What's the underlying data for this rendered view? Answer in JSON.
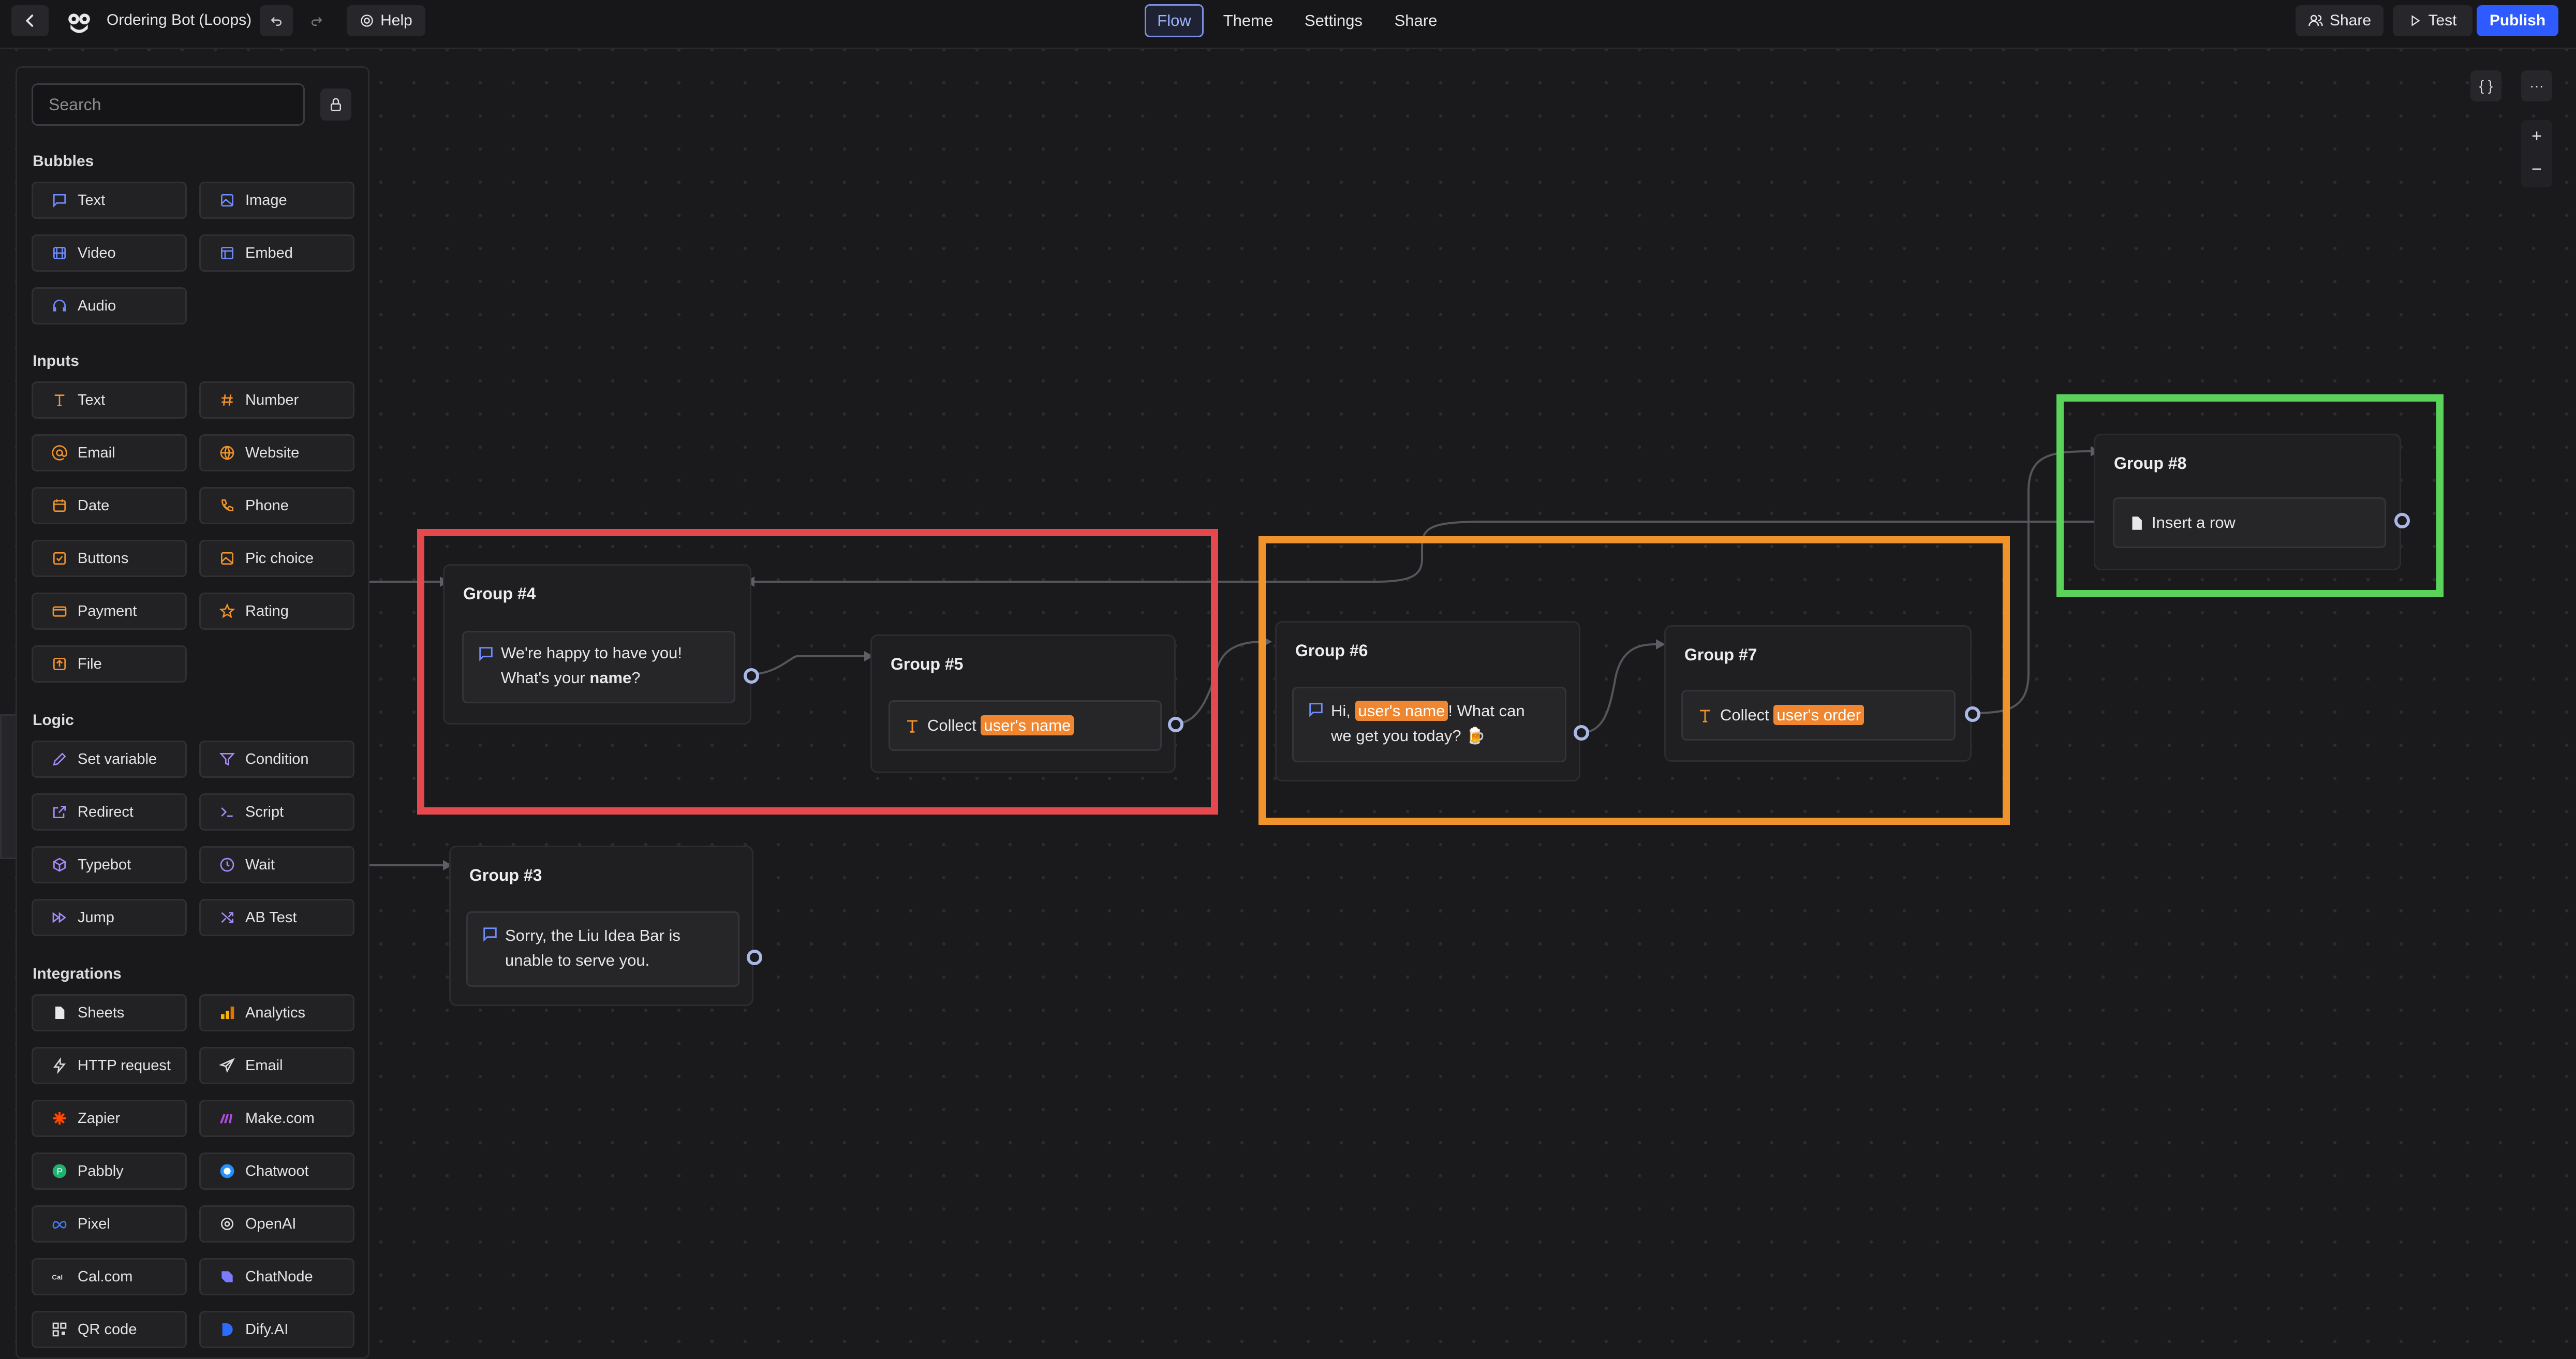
{
  "header": {
    "back_label": "",
    "bot_name": "Ordering Bot (Loops)",
    "help_label": "Help",
    "tabs": [
      {
        "label": "Flow",
        "active": true
      },
      {
        "label": "Theme",
        "active": false
      },
      {
        "label": "Settings",
        "active": false
      },
      {
        "label": "Share",
        "active": false
      }
    ],
    "share_label": "Share",
    "test_label": "Test",
    "publish_label": "Publish"
  },
  "sidebar": {
    "search_placeholder": "Search",
    "sections": {
      "bubbles": "Bubbles",
      "inputs": "Inputs",
      "logic": "Logic",
      "integrations": "Integrations"
    },
    "bubbles": [
      "Text",
      "Image",
      "Video",
      "Embed",
      "Audio"
    ],
    "inputs": [
      "Text",
      "Number",
      "Email",
      "Website",
      "Date",
      "Phone",
      "Buttons",
      "Pic choice",
      "Payment",
      "Rating",
      "File"
    ],
    "logic": [
      "Set variable",
      "Condition",
      "Redirect",
      "Script",
      "Typebot",
      "Wait",
      "Jump",
      "AB Test"
    ],
    "integrations": [
      "Sheets",
      "Analytics",
      "HTTP request",
      "Email",
      "Zapier",
      "Make.com",
      "Pabbly",
      "Chatwoot",
      "Pixel",
      "OpenAI",
      "Cal.com",
      "ChatNode",
      "QR code",
      "Dify.AI"
    ]
  },
  "canvas": {
    "variables_button": "{ }",
    "more_button": "···",
    "zoom_in": "+",
    "zoom_out": "−",
    "groups": {
      "g4": {
        "title": "Group #4",
        "line1": "We're happy to have you!",
        "line2_pre": "What's your ",
        "line2_bold": "name",
        "line2_post": "?"
      },
      "g5": {
        "title": "Group #5",
        "pre": "Collect ",
        "var": "user's name"
      },
      "g6": {
        "title": "Group #6",
        "pre": "Hi, ",
        "var": "user's name",
        "post": "! What can",
        "line2": "we get you today? 🍺"
      },
      "g7": {
        "title": "Group #7",
        "pre": "Collect ",
        "var": "user's order"
      },
      "g8": {
        "title": "Group #8",
        "step": "Insert a row"
      },
      "g3": {
        "title": "Group #3",
        "line1": "Sorry, the Liu Idea Bar is",
        "line2": "unable to serve you."
      }
    },
    "highlight_colors": {
      "red": "#e5484d",
      "orange": "#f0932b",
      "green": "#5bd35b"
    }
  },
  "colors": {
    "accent": "#2d5bff",
    "bubble_icon": "#6f8cff",
    "input_icon": "#f0932b",
    "logic_icon": "#a78bfa"
  }
}
